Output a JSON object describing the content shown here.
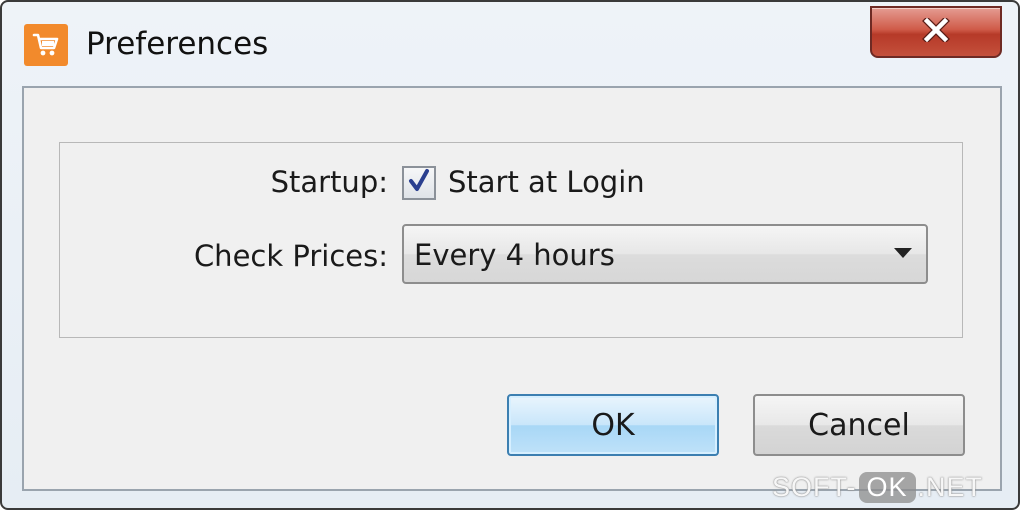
{
  "window": {
    "title": "Preferences",
    "icon": "shopping-cart-icon",
    "close_icon": "close-icon"
  },
  "form": {
    "startup_label": "Startup:",
    "startup_checkbox_label": "Start at Login",
    "startup_checked": true,
    "check_prices_label": "Check Prices:",
    "check_prices_value": "Every 4 hours"
  },
  "buttons": {
    "ok_label": "OK",
    "cancel_label": "Cancel"
  },
  "watermark": {
    "part1": "SOFT-",
    "part2": "OK",
    "part3": ".NET"
  },
  "colors": {
    "app_icon": "#f28a2c",
    "close_button": "#c4503c",
    "ok_button_border": "#3c7fb1",
    "checkmark": "#2a3f8f"
  }
}
